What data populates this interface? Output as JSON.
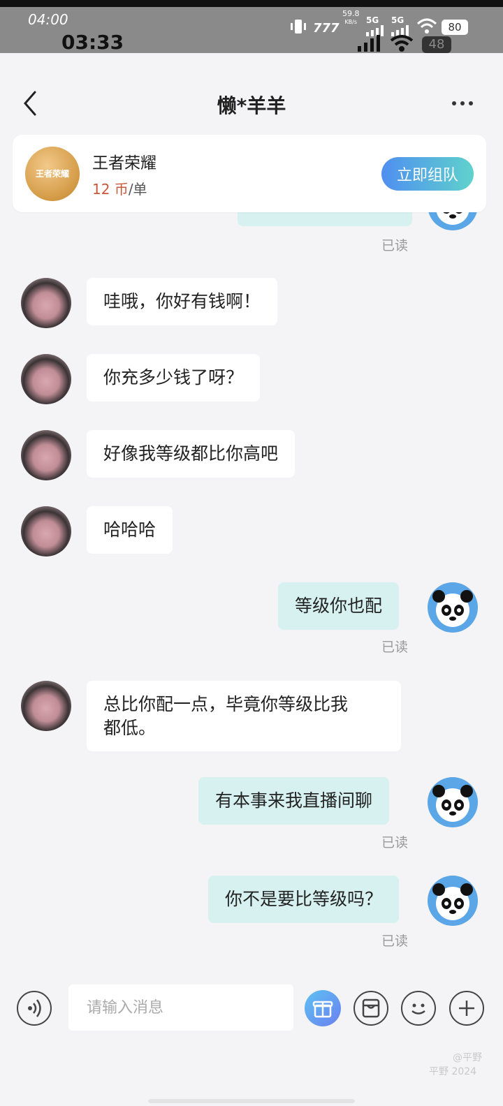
{
  "status_bar": {
    "time_top": "04:00",
    "time_main": "03:33",
    "net_speed": "59.8",
    "net_unit": "KB/s",
    "signal1": "5G",
    "signal2": "5G",
    "battery": "80",
    "battery2": "48"
  },
  "header": {
    "title": "懒*羊羊"
  },
  "game_card": {
    "name": "王者荣耀",
    "logo_text": "王者荣耀",
    "price_value": "12 币",
    "price_unit": "/单",
    "button": "立即组队"
  },
  "messages": [
    {
      "side": "out",
      "text": "",
      "read": "已读"
    },
    {
      "side": "in",
      "text": "哇哦，你好有钱啊！"
    },
    {
      "side": "in",
      "text": "你充多少钱了呀？"
    },
    {
      "side": "in",
      "text": "好像我等级都比你高吧"
    },
    {
      "side": "in",
      "text": "哈哈哈"
    },
    {
      "side": "out",
      "text": "等级你也配",
      "read": "已读"
    },
    {
      "side": "in",
      "text_line1": "总比你配一点，毕竟你等级比我",
      "text_line2": "都低。"
    },
    {
      "side": "out",
      "text": "有本事来我直播间聊",
      "read": "已读"
    },
    {
      "side": "out",
      "text": "你不是要比等级吗？",
      "read": "已读"
    }
  ],
  "composer": {
    "placeholder": "请输入消息"
  },
  "watermark": {
    "line1": "@平野",
    "line2": "平野 2024"
  },
  "colors": {
    "incoming_bubble": "#ffffff",
    "outgoing_bubble": "#d6f1f0",
    "accent_button": "#4f8ff0",
    "price": "#c9573b"
  }
}
